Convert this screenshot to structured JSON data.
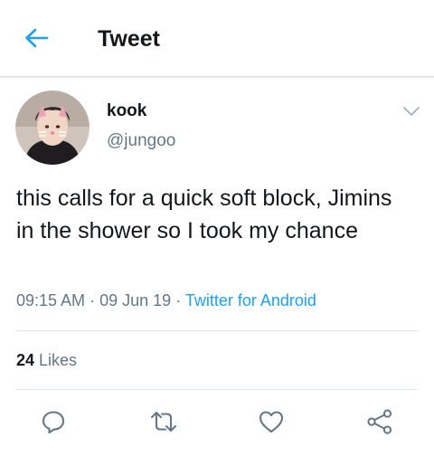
{
  "header": {
    "title": "Tweet",
    "back_icon": "arrow-left-icon"
  },
  "tweet": {
    "author": {
      "name": "kook",
      "handle": "@jungoo"
    },
    "text": "this calls for a quick soft block, Jimins in the shower so I took my chance",
    "time": "09:15 AM",
    "date": "09 Jun 19",
    "source": "Twitter for Android",
    "separator": "·",
    "likes": {
      "count": "24",
      "label": "Likes"
    },
    "actions": [
      "reply-icon",
      "retweet-icon",
      "like-icon",
      "share-icon"
    ]
  },
  "colors": {
    "accent": "#1da1f2",
    "text": "#14171a",
    "secondary": "#657786",
    "divider": "#e1e8ed"
  }
}
